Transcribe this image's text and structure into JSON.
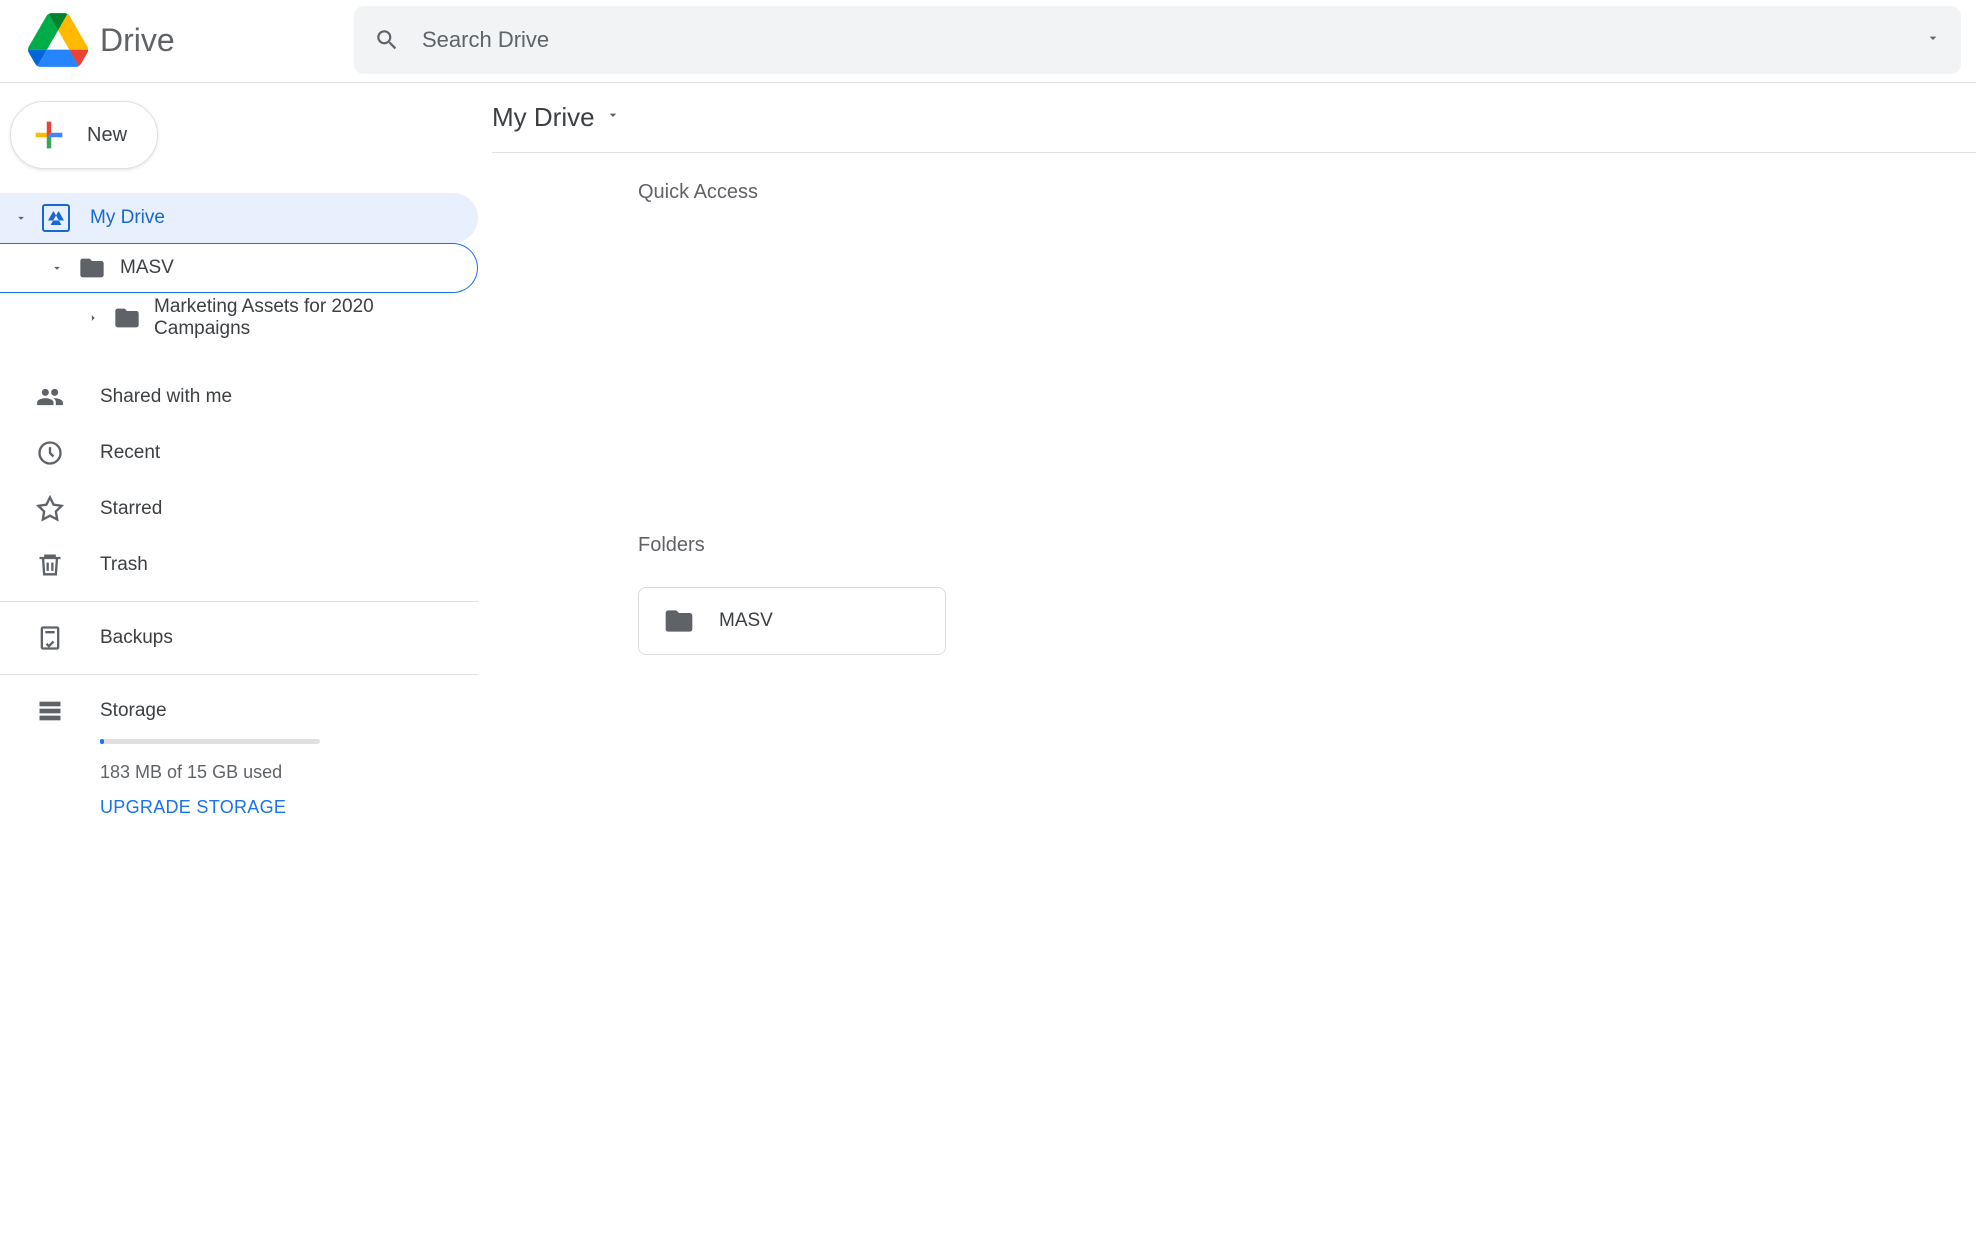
{
  "header": {
    "app_name": "Drive",
    "search_placeholder": "Search Drive"
  },
  "sidebar": {
    "new_label": "New",
    "tree": {
      "root": "My Drive",
      "child1": "MASV",
      "child2": "Marketing Assets for 2020 Campaigns"
    },
    "nav": {
      "shared": "Shared with me",
      "recent": "Recent",
      "starred": "Starred",
      "trash": "Trash",
      "backups": "Backups"
    },
    "storage": {
      "label": "Storage",
      "usage_text": "183 MB of 15 GB used",
      "upgrade_label": "UPGRADE STORAGE"
    }
  },
  "main": {
    "breadcrumb": "My Drive",
    "quick_access_label": "Quick Access",
    "folders_label": "Folders",
    "folders": {
      "0": {
        "name": "MASV"
      }
    }
  }
}
